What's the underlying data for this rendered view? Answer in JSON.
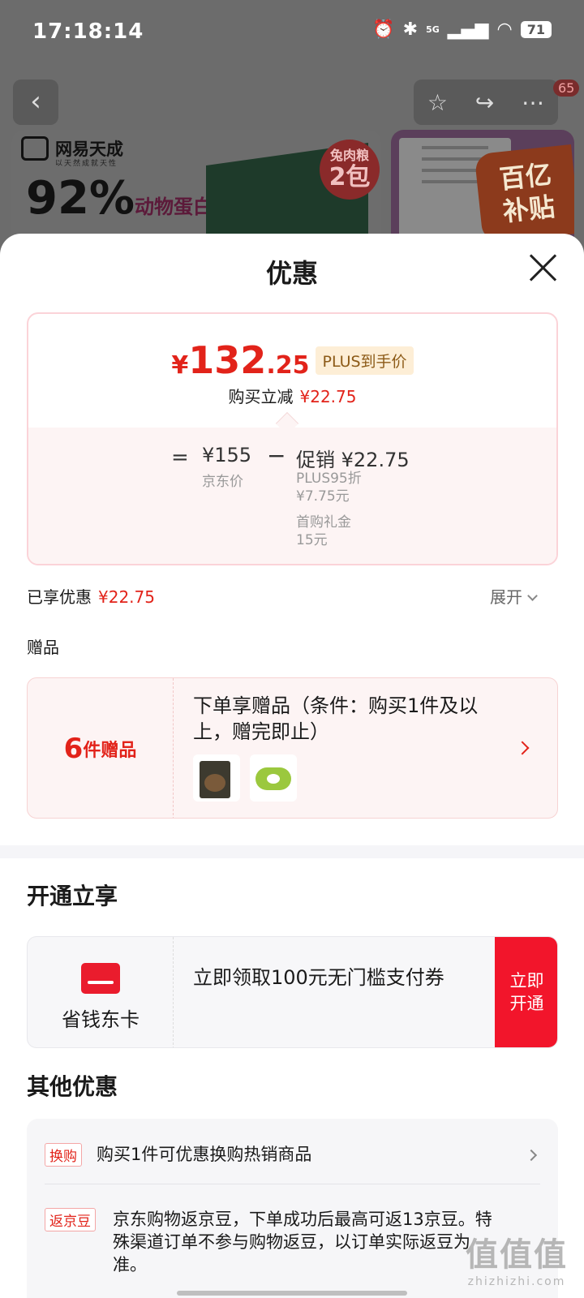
{
  "status_bar": {
    "time": "17:18:14",
    "network": "5G",
    "battery": "71"
  },
  "background_page": {
    "badge_count": "65",
    "brand_name": "网易天成",
    "brand_slogan": "以天然成就天性",
    "promo_text": "92%",
    "promo_suffix": "动物蛋白",
    "badge_line1": "兔肉粮",
    "badge_line2": "2包",
    "subsidy_line1": "百亿",
    "subsidy_line2": "补贴"
  },
  "sheet": {
    "title": "优惠",
    "price": {
      "currency": "¥",
      "integer": "132",
      "decimal": ".25",
      "tag": "PLUS到手价"
    },
    "instant_reduce": {
      "label": "购买立减",
      "value": "¥22.75"
    },
    "breakdown": {
      "equals": "=",
      "jd_price": "¥155",
      "jd_label": "京东价",
      "minus": "−",
      "promo_label": "促销",
      "promo_value": "¥22.75",
      "items": [
        {
          "name": "PLUS95折",
          "amount": "¥7.75元"
        },
        {
          "name": "首购礼金",
          "amount": "15元"
        }
      ]
    },
    "enjoyed": {
      "label": "已享优惠",
      "value": "¥22.75",
      "expand_label": "展开"
    },
    "gifts": {
      "section_label": "赠品",
      "count_number": "6",
      "count_suffix": "件赠品",
      "description": "下单享赠品（条件：购买1件及以上，赠完即止）"
    },
    "open_section": {
      "title": "开通立享",
      "card_name": "省钱东卡",
      "card_desc": "立即领取100元无门槛支付券",
      "button_line1": "立即",
      "button_line2": "开通"
    },
    "other_section": {
      "title": "其他优惠",
      "items": [
        {
          "tag": "换购",
          "text": "购买1件可优惠换购热销商品"
        },
        {
          "tag": "返京豆",
          "text": "京东购物返京豆，下单成功后最高可返13京豆。特殊渠道订单不参与购物返豆，以订单实际返豆为准。"
        }
      ]
    }
  },
  "watermark": {
    "big": "值值值",
    "small": "zhizhizhi.com"
  },
  "colors": {
    "accent": "#e2231a",
    "button": "#f2152b",
    "plus_tag_bg": "#fdeed6"
  }
}
